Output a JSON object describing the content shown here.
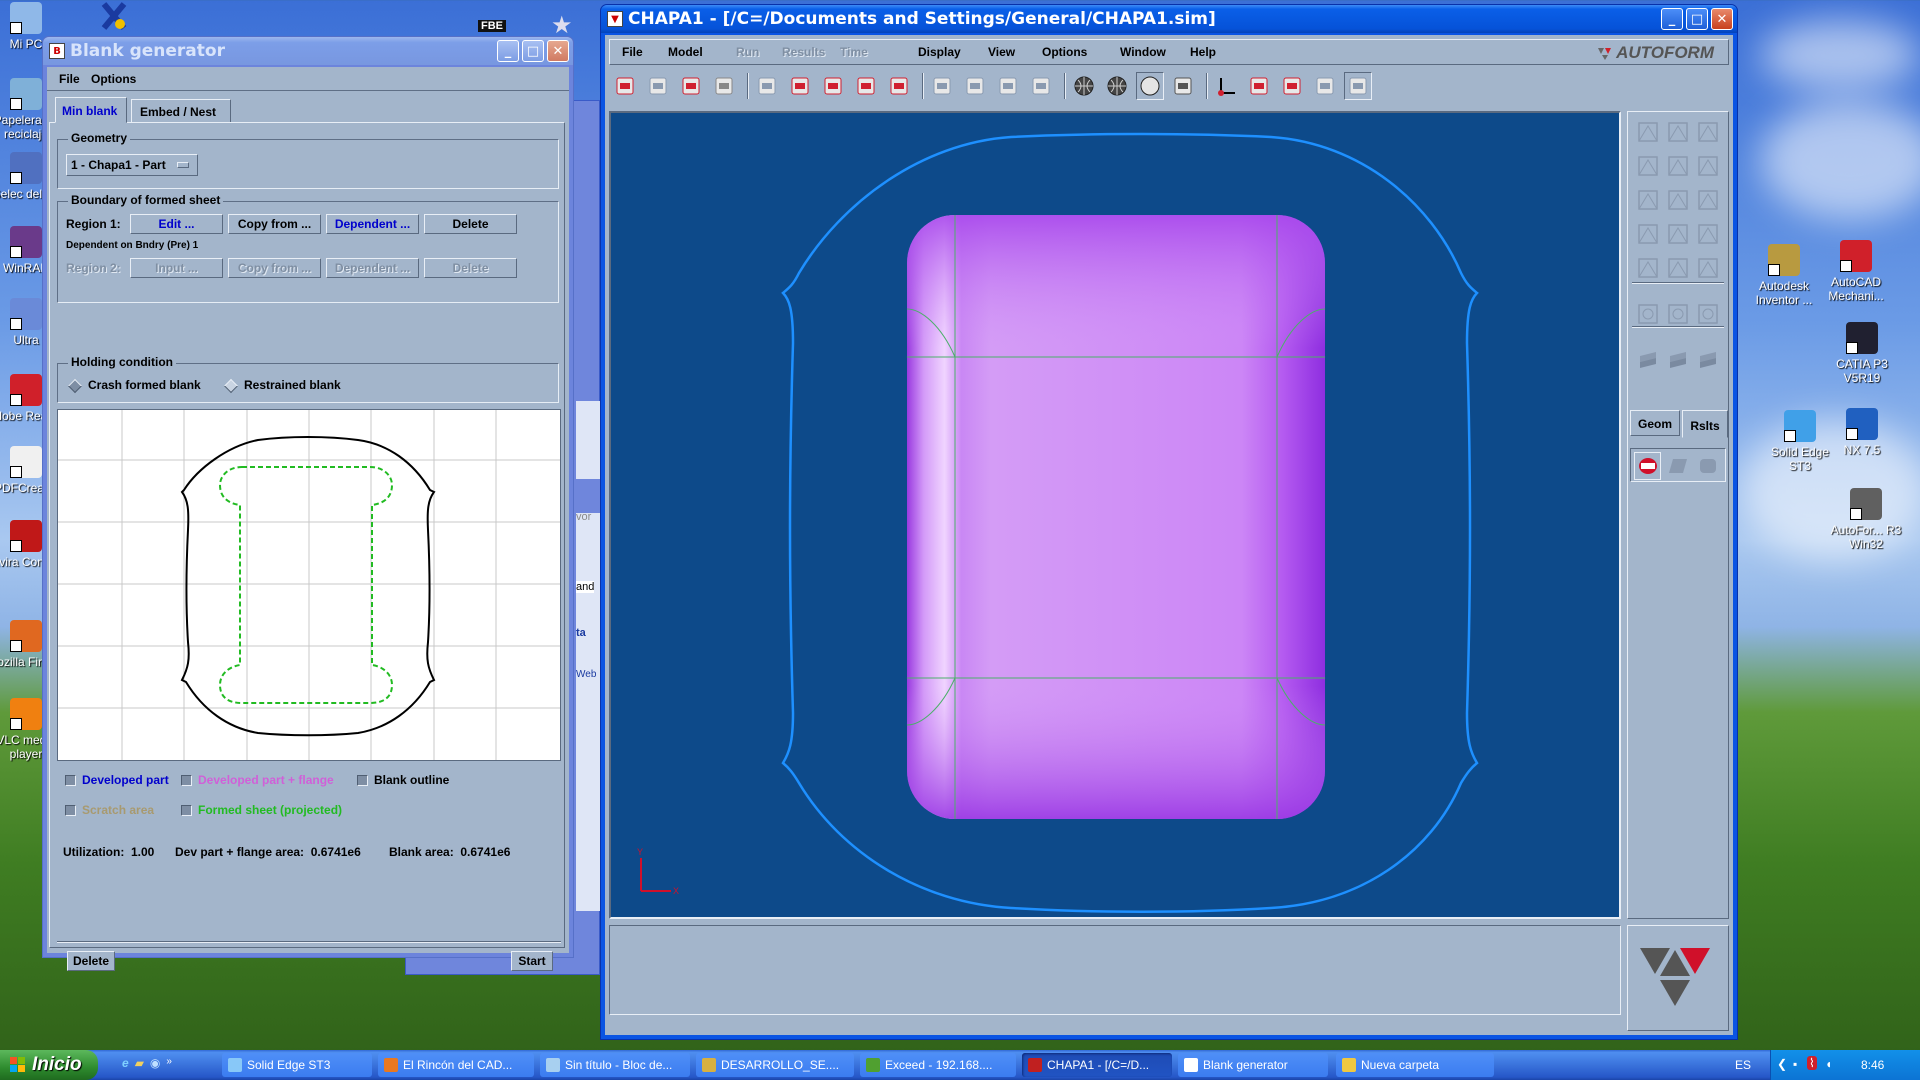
{
  "desktop": {
    "left_icons": [
      {
        "label": "Mi PC",
        "icon": "my-computer-icon"
      },
      {
        "label": "Papelera de reciclaje",
        "icon": "recycle-bin-icon"
      },
      {
        "label": "Selec del Ex",
        "icon": "select-icon"
      },
      {
        "label": "WinRAR",
        "icon": "winrar-icon"
      },
      {
        "label": "Ultra",
        "icon": "ultraiso-icon"
      },
      {
        "label": "Adobe Reader",
        "icon": "adobe-reader-icon"
      },
      {
        "label": "PDFCreator",
        "icon": "pdfcreator-icon"
      },
      {
        "label": "Avira Control",
        "icon": "avira-icon"
      },
      {
        "label": "Mozilla Firefox",
        "icon": "firefox-icon"
      },
      {
        "label": "VLC media player",
        "icon": "vlc-icon"
      }
    ],
    "right_icons": [
      {
        "label": "Autodesk Inventor ...",
        "icon": "inventor-icon"
      },
      {
        "label": "AutoCAD Mechani...",
        "icon": "autocad-icon"
      },
      {
        "label": "CATIA P3 V5R19",
        "icon": "catia-icon"
      },
      {
        "label": "Solid Edge ST3",
        "icon": "solid-edge-icon"
      },
      {
        "label": "NX 7.5",
        "icon": "nx-icon"
      },
      {
        "label": "AutoFor... R3 Win32",
        "icon": "autoform-icon"
      }
    ],
    "top_items": {
      "fbe": "FBE"
    }
  },
  "blank_generator": {
    "title": "Blank generator",
    "menu": [
      "File",
      "Options"
    ],
    "tabs": [
      {
        "label": "Min blank",
        "active": true
      },
      {
        "label": "Embed / Nest",
        "active": false
      }
    ],
    "geometry": {
      "legend": "Geometry",
      "selected": "1 - Chapa1 - Part"
    },
    "boundary": {
      "legend": "Boundary of formed sheet",
      "region1": {
        "label": "Region 1:",
        "buttons": [
          "Edit ...",
          "Copy from ...",
          "Dependent ...",
          "Delete"
        ]
      },
      "dependent_note": "Dependent on Bndry (Pre) 1",
      "region2": {
        "label": "Region 2:",
        "buttons": [
          "Input ...",
          "Copy from ...",
          "Dependent ...",
          "Delete"
        ]
      }
    },
    "holding": {
      "legend": "Holding condition",
      "options": [
        {
          "label": "Crash formed blank",
          "selected": true
        },
        {
          "label": "Restrained blank",
          "selected": false
        }
      ]
    },
    "legend_checks": [
      {
        "label": "Developed part",
        "color": "#0000cc",
        "enabled": true
      },
      {
        "label": "Developed part + flange",
        "color": "#cc44cc",
        "enabled": false
      },
      {
        "label": "Blank outline",
        "color": "#000000",
        "enabled": true
      },
      {
        "label": "Scratch area",
        "color": "#a08c60",
        "enabled": false
      },
      {
        "label": "Formed sheet (projected)",
        "color": "#22bb22",
        "enabled": true
      }
    ],
    "stats": {
      "utilization": "Utilization:  1.00",
      "dev_area": "Dev part + flange area:  0.6741e6",
      "blank_area": "Blank area:  0.6741e6"
    },
    "buttons": {
      "delete": "Delete",
      "start": "Start"
    }
  },
  "background_window_fragments": [
    "vor",
    "and",
    "ta",
    "Web"
  ],
  "autoform": {
    "title": "CHAPA1 - [/C=/Documents and Settings/General/CHAPA1.sim]",
    "brand": "AUTOFORM",
    "menu": [
      {
        "label": "File",
        "enabled": true
      },
      {
        "label": "Model",
        "enabled": true
      },
      {
        "label": "Run",
        "enabled": false
      },
      {
        "label": "Results",
        "enabled": false
      },
      {
        "label": "Time",
        "enabled": false
      },
      {
        "label": "Display",
        "enabled": true
      },
      {
        "label": "View",
        "enabled": true
      },
      {
        "label": "Options",
        "enabled": true
      },
      {
        "label": "Window",
        "enabled": true
      },
      {
        "label": "Help",
        "enabled": true
      }
    ],
    "toolbar": [
      "open-icon",
      "import-icon",
      "save-icon",
      "print-icon",
      "sheet-icon",
      "die-icon",
      "punch-icon",
      "binder-icon",
      "curve-icon",
      "ruler-up-icon",
      "ruler-down-icon",
      "check-icon",
      "distribution-icon",
      "wireframe-sphere-icon",
      "mesh-sphere-icon",
      "shaded-sphere-icon",
      "notes-icon",
      "axes-icon",
      "fit-view-icon",
      "rotate-view-icon",
      "mirror-icon",
      "tool-icon"
    ],
    "side_tabs": [
      {
        "label": "Geom",
        "active": false
      },
      {
        "label": "Rslts",
        "active": true
      }
    ],
    "axis_labels": {
      "x": "X",
      "y": "Y"
    }
  },
  "taskbar": {
    "start_label": "Inicio",
    "tasks": [
      {
        "label": "Solid Edge ST3",
        "active": false,
        "color": "#88c8f8"
      },
      {
        "label": "El Rincón del CAD...",
        "active": false,
        "color": "#e87820"
      },
      {
        "label": "Sin título - Bloc de...",
        "active": false,
        "color": "#a8d0f0"
      },
      {
        "label": "DESARROLLO_SE....",
        "active": false,
        "color": "#d8b040"
      },
      {
        "label": "Exceed - 192.168....",
        "active": false,
        "color": "#50a030"
      },
      {
        "label": "CHAPA1 - [/C=/D...",
        "active": true,
        "color": "#c02020"
      },
      {
        "label": "Blank generator",
        "active": false,
        "color": "#ffffff"
      },
      {
        "label": "Nueva carpeta",
        "active": false,
        "color": "#f0c840"
      }
    ],
    "language": "ES",
    "clock": "8:46"
  }
}
